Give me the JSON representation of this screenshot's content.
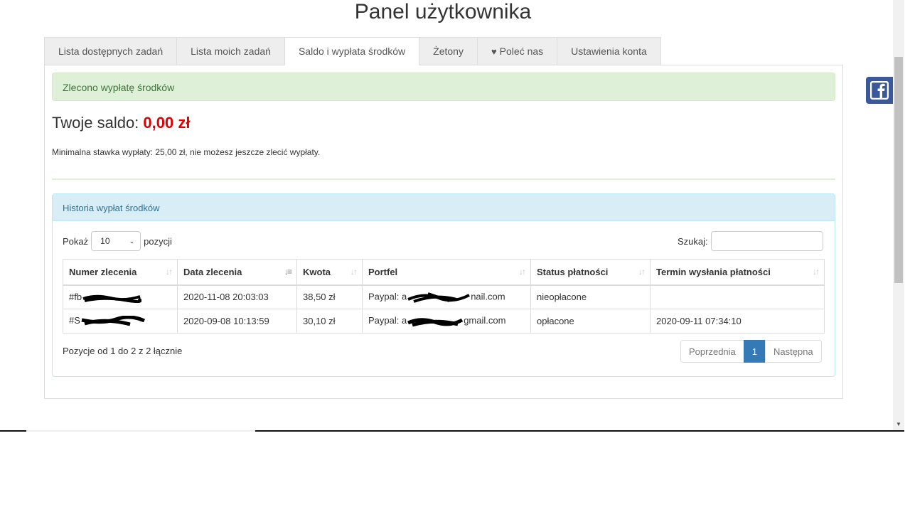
{
  "page": {
    "title": "Panel użytkownika"
  },
  "tabs": [
    {
      "label": "Lista dostępnych zadań"
    },
    {
      "label": "Lista moich zadań"
    },
    {
      "label": "Saldo i wypłata środków"
    },
    {
      "label": "Żetony"
    },
    {
      "label": "Poleć nas"
    },
    {
      "label": "Ustawienia konta"
    }
  ],
  "alert": {
    "text": "Zlecono wypłatę środków"
  },
  "balance": {
    "label": "Twoje saldo:",
    "amount": "0,00 zł"
  },
  "min_note": "Minimalna stawka wypłaty: 25,00 zł, nie możesz jeszcze zlecić wypłaty.",
  "history": {
    "title": "Historia wypłat środków",
    "length": {
      "before": "Pokaż",
      "value": "10",
      "after": "pozycji"
    },
    "search_label": "Szukaj:",
    "columns": [
      "Numer zlecenia",
      "Data zlecenia",
      "Kwota",
      "Portfel",
      "Status płatności",
      "Termin wysłania płatności"
    ],
    "rows": [
      {
        "id_prefix": "#fb",
        "date": "2020-11-08 20:03:03",
        "amount": "38,50 zł",
        "wallet_prefix": "Paypal: a",
        "wallet_suffix": "nail.com",
        "status": "nieopłacone",
        "sent": ""
      },
      {
        "id_prefix": "#S",
        "date": "2020-09-08 10:13:59",
        "amount": "30,10 zł",
        "wallet_prefix": "Paypal: a",
        "wallet_suffix": "gmail.com",
        "status": "opłacone",
        "sent": "2020-09-11 07:34:10"
      }
    ],
    "info": "Pozycje od 1 do 2 z 2 łącznie",
    "pager": {
      "prev": "Poprzednia",
      "current": "1",
      "next": "Następna"
    }
  },
  "icons": {
    "favorite": "heart-icon",
    "social": "facebook-icon"
  },
  "colors": {
    "balance_amount": "#e00000",
    "alert_bg": "#dff0d8",
    "pager_active": "#337ab7",
    "facebook": "#3b5998"
  }
}
